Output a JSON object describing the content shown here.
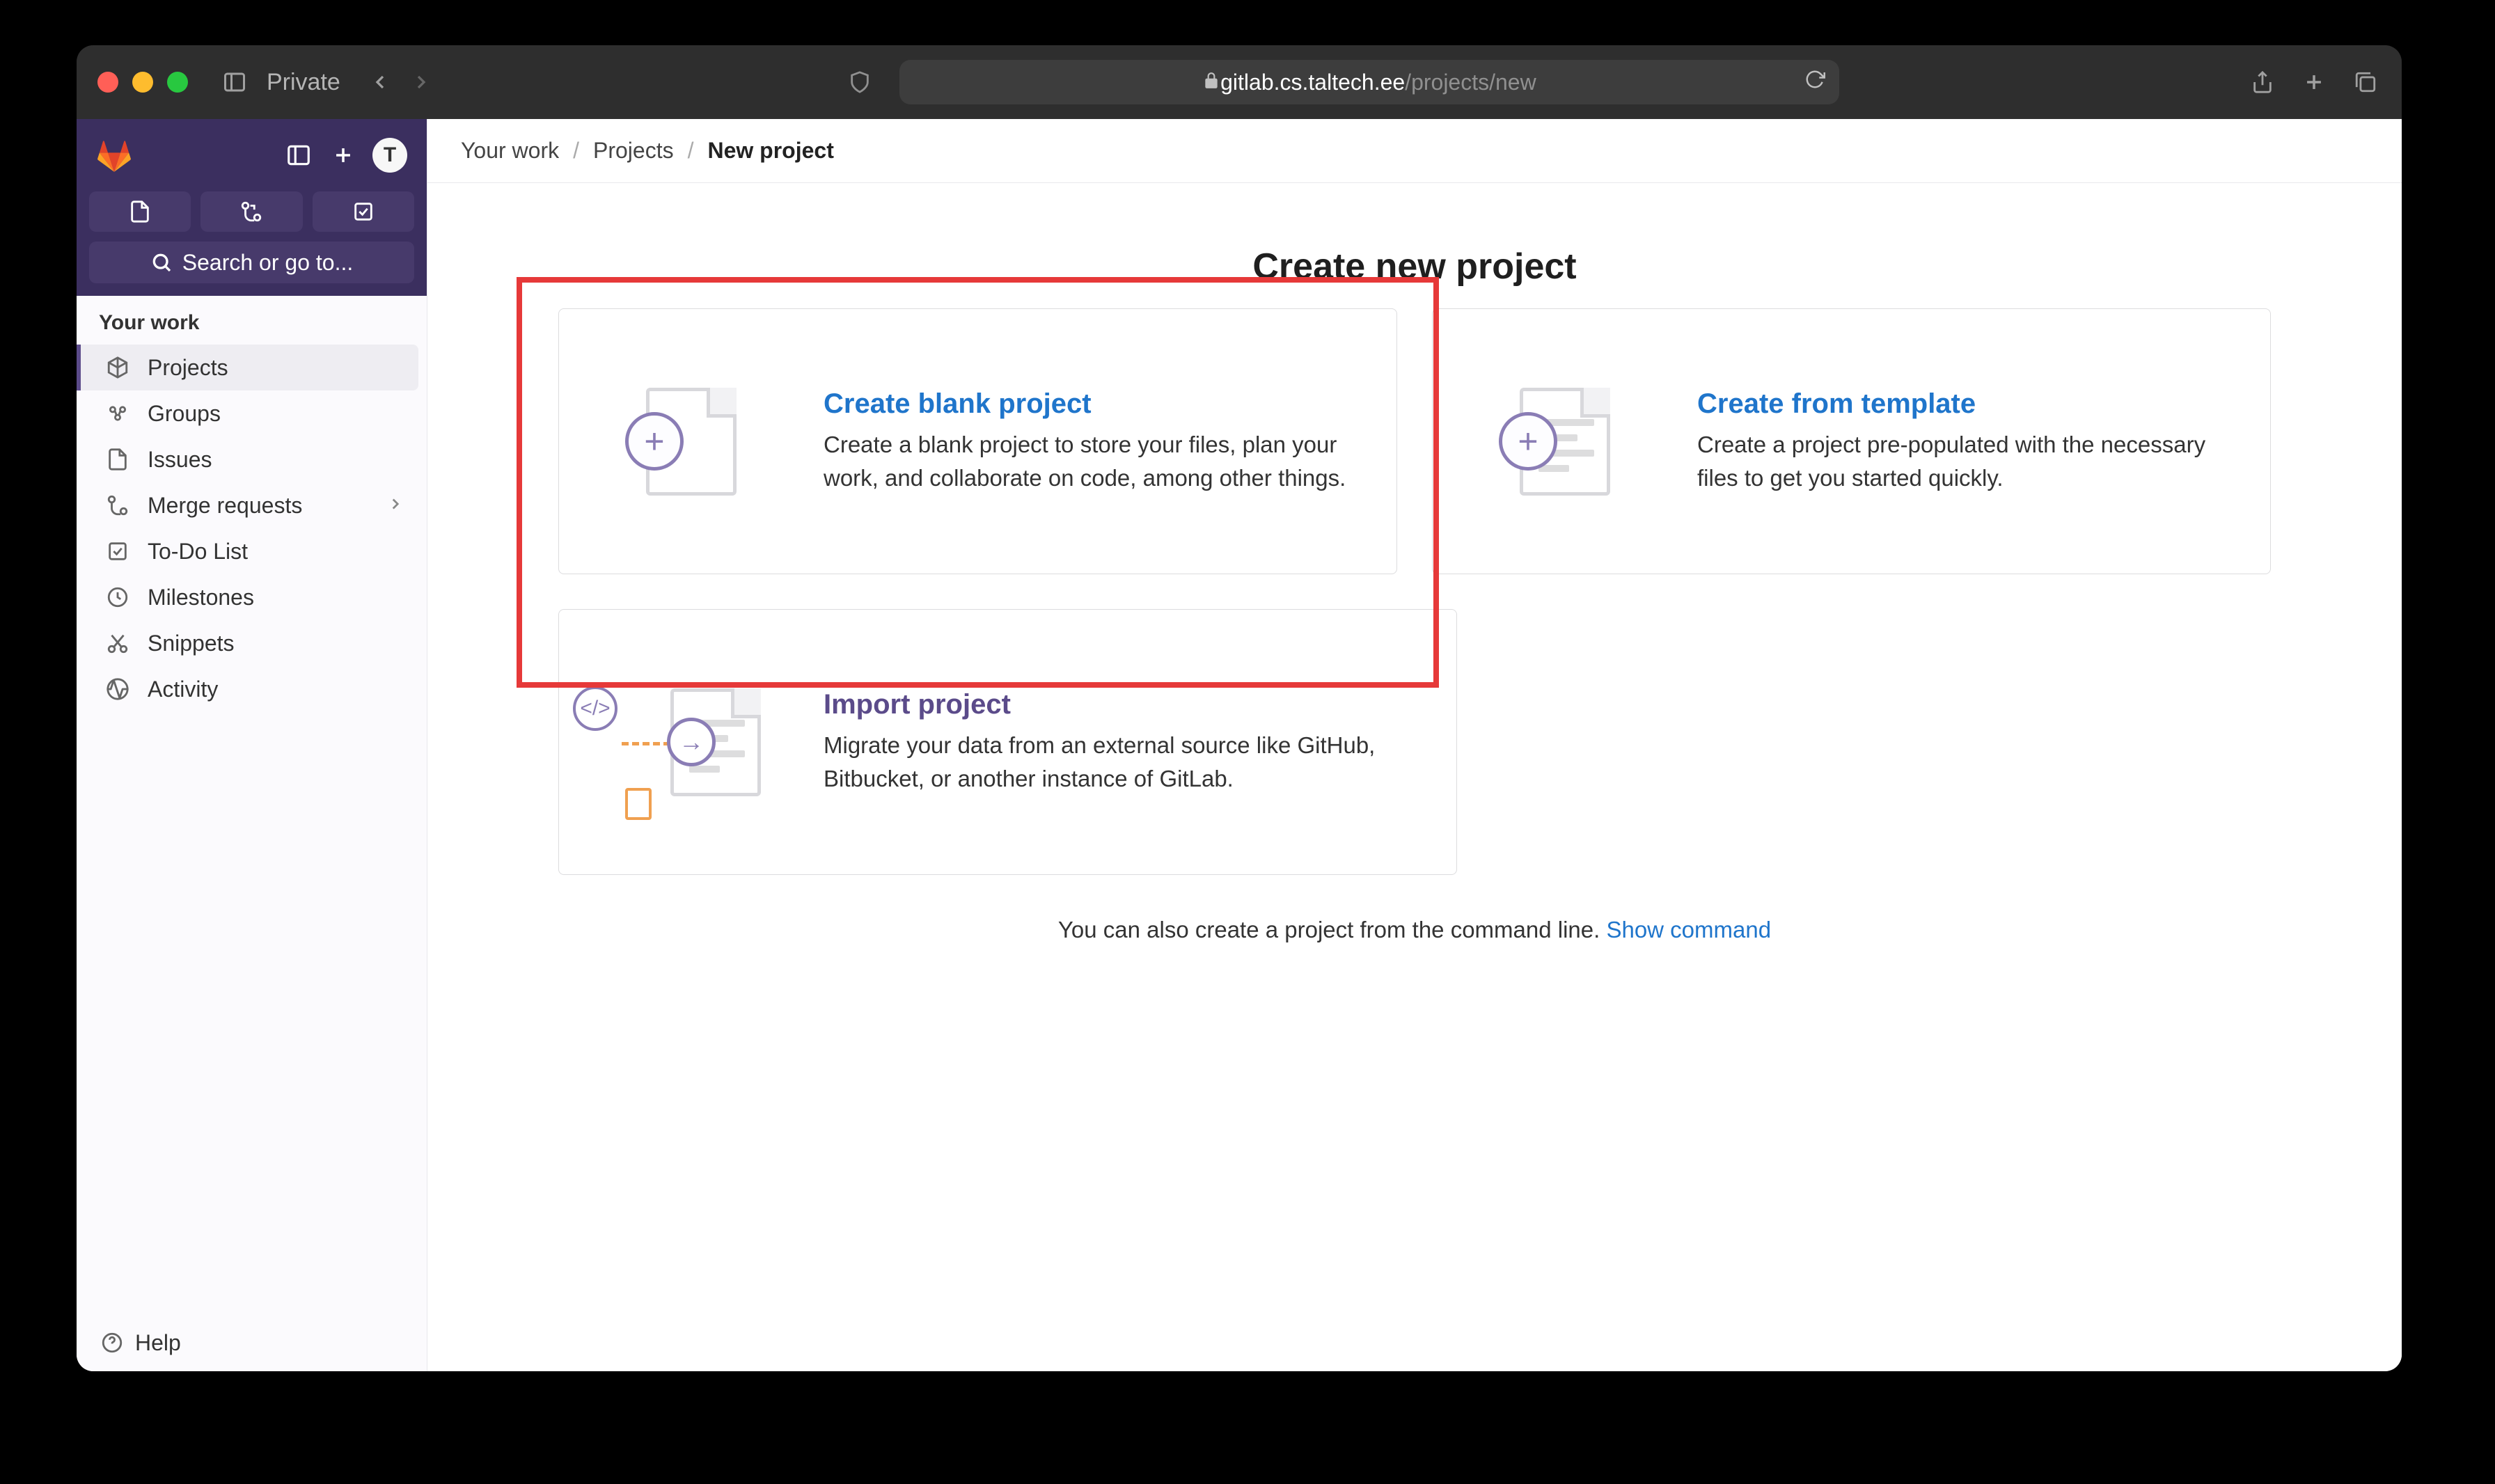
{
  "browser": {
    "private_label": "Private",
    "url_host": "gitlab.cs.taltech.ee",
    "url_path": "/projects/new"
  },
  "sidebar": {
    "avatar_letter": "T",
    "search_placeholder": "Search or go to...",
    "section_label": "Your work",
    "items": [
      {
        "label": "Projects",
        "icon": "project-icon",
        "active": true
      },
      {
        "label": "Groups",
        "icon": "group-icon"
      },
      {
        "label": "Issues",
        "icon": "issues-icon"
      },
      {
        "label": "Merge requests",
        "icon": "merge-icon",
        "chevron": true
      },
      {
        "label": "To-Do List",
        "icon": "todo-icon"
      },
      {
        "label": "Milestones",
        "icon": "clock-icon"
      },
      {
        "label": "Snippets",
        "icon": "snippets-icon"
      },
      {
        "label": "Activity",
        "icon": "activity-icon"
      }
    ],
    "help_label": "Help"
  },
  "breadcrumb": {
    "items": [
      "Your work",
      "Projects",
      "New project"
    ]
  },
  "page": {
    "title": "Create new project",
    "cards": [
      {
        "title": "Create blank project",
        "desc": "Create a blank project to store your files, plan your work, and collaborate on code, among other things.",
        "highlighted": true
      },
      {
        "title": "Create from template",
        "desc": "Create a project pre-populated with the necessary files to get you started quickly."
      },
      {
        "title": "Import project",
        "desc": "Migrate your data from an external source like GitHub, Bitbucket, or another instance of GitLab.",
        "style": "purple"
      }
    ],
    "cmdline_prefix": "You can also create a project from the command line. ",
    "cmdline_link": "Show command"
  }
}
